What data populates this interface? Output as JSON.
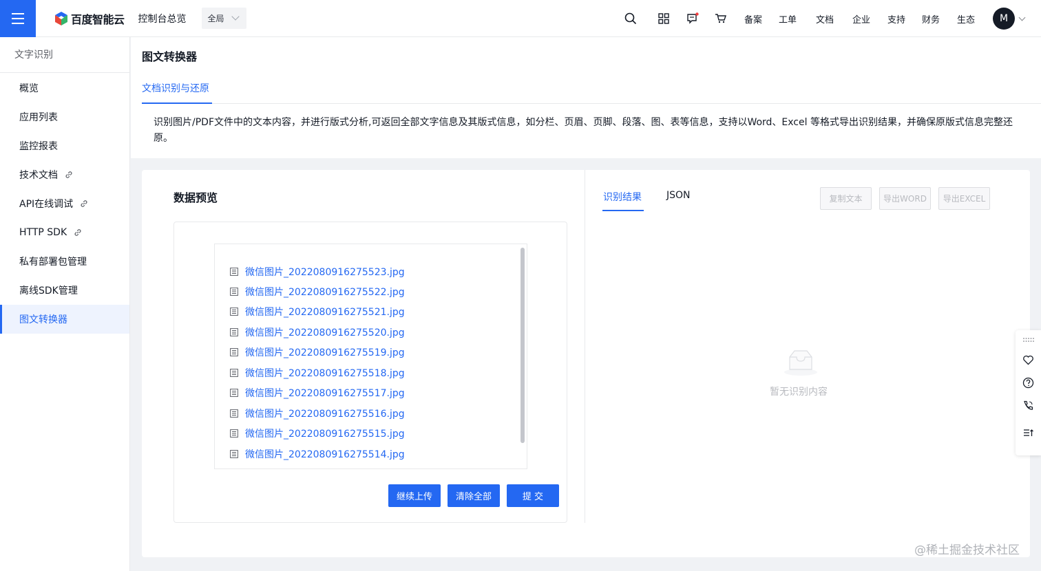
{
  "topbar": {
    "brand": "百度智能云",
    "console_title": "控制台总览",
    "region": "全局",
    "nav": [
      "备案",
      "工单",
      "文档",
      "企业",
      "支持",
      "财务",
      "生态"
    ],
    "avatar_letter": "M",
    "brand_color": "#2468f2"
  },
  "sidebar": {
    "title": "文字识别",
    "items": [
      {
        "label": "概览"
      },
      {
        "label": "应用列表"
      },
      {
        "label": "监控报表"
      },
      {
        "label": "技术文档"
      },
      {
        "label": "API在线调试"
      },
      {
        "label": "HTTP SDK"
      },
      {
        "label": "私有部署包管理"
      },
      {
        "label": "离线SDK管理"
      },
      {
        "label": "图文转换器"
      }
    ]
  },
  "header": {
    "page_title": "图文转换器",
    "tab": "文档识别与还原",
    "description": "识别图片/PDF文件中的文本内容，并进行版式分析,可返回全部文字信息及其版式信息，如分栏、页眉、页脚、段落、图、表等信息，支持以Word、Excel 等格式导出识别结果，并确保原版式信息完整还原。"
  },
  "preview": {
    "title": "数据预览",
    "files": [
      "微信图片_2022080916275523.jpg",
      "微信图片_2022080916275522.jpg",
      "微信图片_2022080916275521.jpg",
      "微信图片_2022080916275520.jpg",
      "微信图片_2022080916275519.jpg",
      "微信图片_2022080916275518.jpg",
      "微信图片_2022080916275517.jpg",
      "微信图片_2022080916275516.jpg",
      "微信图片_2022080916275515.jpg",
      "微信图片_2022080916275514.jpg"
    ],
    "buttons": {
      "continue": "继续上传",
      "clear": "清除全部",
      "submit": "提 交"
    }
  },
  "result": {
    "tabs": [
      "识别结果",
      "JSON"
    ],
    "buttons": {
      "copy": "复制文本",
      "word": "导出WORD",
      "excel": "导出EXCEL"
    },
    "empty_text": "暂无识别内容"
  },
  "watermark": "@稀土掘金技术社区"
}
